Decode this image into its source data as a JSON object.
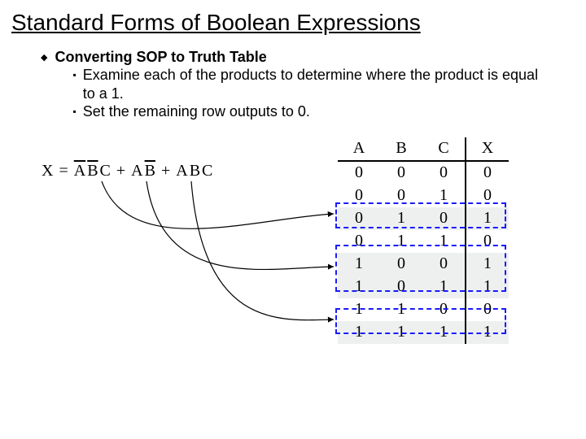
{
  "title": "Standard Forms of Boolean Expressions",
  "heading": "Converting SOP to Truth Table",
  "sub1": "Examine each of the products to determine where the product is equal to a 1.",
  "sub2": "Set the remaining row outputs to 0.",
  "eq": {
    "lhs": "X",
    "eq": "=",
    "t1a": "A",
    "t1b": "B",
    "t1c": "C",
    "plus1": "+",
    "t2a": "A",
    "t2b": "B",
    "plus2": "+",
    "t3a": "A",
    "t3b": "B",
    "t3c": "C"
  },
  "truth": {
    "headers": [
      "A",
      "B",
      "C",
      "X"
    ],
    "rows": [
      [
        "0",
        "0",
        "0",
        "0"
      ],
      [
        "0",
        "0",
        "1",
        "0"
      ],
      [
        "0",
        "1",
        "0",
        "1"
      ],
      [
        "0",
        "1",
        "1",
        "0"
      ],
      [
        "1",
        "0",
        "0",
        "1"
      ],
      [
        "1",
        "0",
        "1",
        "1"
      ],
      [
        "1",
        "1",
        "0",
        "0"
      ],
      [
        "1",
        "1",
        "1",
        "1"
      ]
    ]
  },
  "chart_data": {
    "type": "table",
    "title": "Truth table for X = A'B'C + AB' + ABC",
    "columns": [
      "A",
      "B",
      "C",
      "X"
    ],
    "rows": [
      {
        "A": 0,
        "B": 0,
        "C": 0,
        "X": 0
      },
      {
        "A": 0,
        "B": 0,
        "C": 1,
        "X": 0
      },
      {
        "A": 0,
        "B": 1,
        "C": 0,
        "X": 1
      },
      {
        "A": 0,
        "B": 1,
        "C": 1,
        "X": 0
      },
      {
        "A": 1,
        "B": 0,
        "C": 0,
        "X": 1
      },
      {
        "A": 1,
        "B": 0,
        "C": 1,
        "X": 1
      },
      {
        "A": 1,
        "B": 1,
        "C": 0,
        "X": 0
      },
      {
        "A": 1,
        "B": 1,
        "C": 1,
        "X": 1
      }
    ],
    "highlighted_rows": [
      2,
      4,
      5,
      7
    ],
    "equation": "X = \\bar{A}\\bar{B}C + A\\bar{B} + ABC"
  }
}
